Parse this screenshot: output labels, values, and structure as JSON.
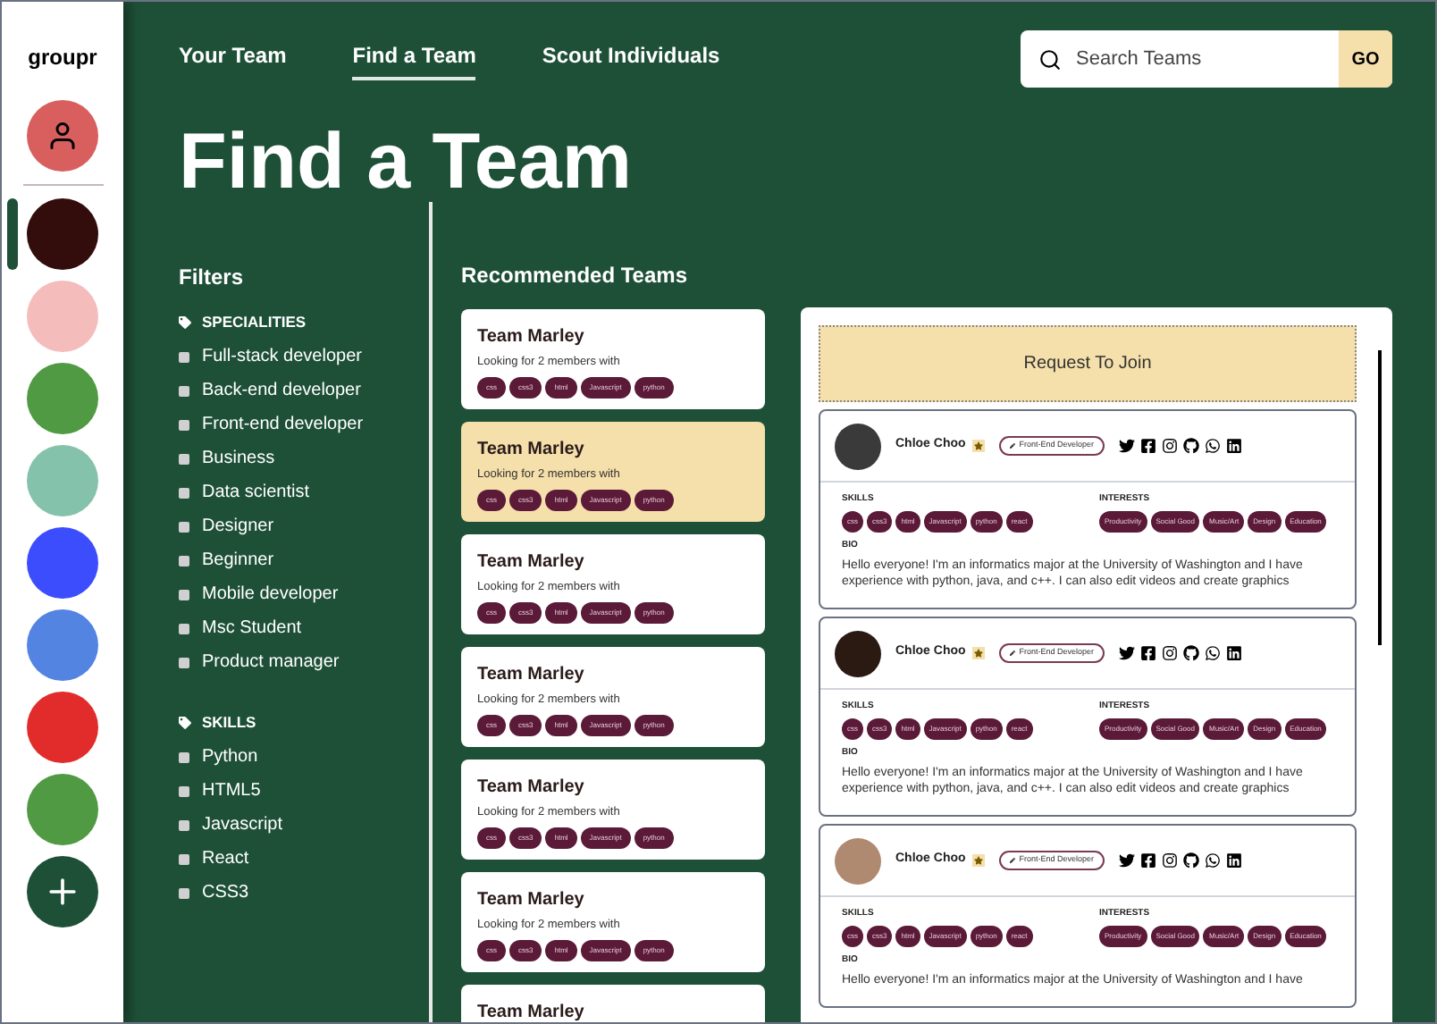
{
  "app": {
    "name": "groupr"
  },
  "groups": [
    {
      "color": "#330c0c",
      "selected": true
    },
    {
      "color": "#f5bcbc",
      "selected": false
    },
    {
      "color": "#4f9a42",
      "selected": false
    },
    {
      "color": "#85c2ab",
      "selected": false
    },
    {
      "color": "#3b4dfd",
      "selected": false
    },
    {
      "color": "#5384e2",
      "selected": false
    },
    {
      "color": "#e22b2b",
      "selected": false
    },
    {
      "color": "#4f9a42",
      "selected": false
    }
  ],
  "nav": [
    {
      "label": "Your Team",
      "selected": false
    },
    {
      "label": "Find a Team",
      "selected": true
    },
    {
      "label": "Scout Individuals",
      "selected": false
    }
  ],
  "search": {
    "placeholder": "Search Teams",
    "button": "GO"
  },
  "title": "Find a Team",
  "filters": {
    "title": "Filters",
    "sections": [
      {
        "heading": "SPECIALITIES",
        "items": [
          {
            "label": "Full-stack developer",
            "checked": false
          },
          {
            "label": "Back-end developer",
            "checked": false
          },
          {
            "label": "Front-end developer",
            "checked": false
          },
          {
            "label": "Business",
            "checked": false
          },
          {
            "label": "Data scientist",
            "checked": false
          },
          {
            "label": "Designer",
            "checked": false
          },
          {
            "label": "Beginner",
            "checked": false
          },
          {
            "label": "Mobile developer",
            "checked": false
          },
          {
            "label": "Msc Student",
            "checked": false
          },
          {
            "label": "Product manager",
            "checked": false
          }
        ]
      },
      {
        "heading": "SKILLS",
        "items": [
          {
            "label": "Python",
            "checked": false
          },
          {
            "label": "HTML5",
            "checked": false
          },
          {
            "label": "Javascript",
            "checked": false
          },
          {
            "label": "React",
            "checked": false
          },
          {
            "label": "CSS3",
            "checked": false
          }
        ]
      }
    ]
  },
  "recommended": {
    "title": "Recommended Teams",
    "teams": [
      {
        "name": "Team Marley",
        "selected": false,
        "looking": "Looking for 2 members with",
        "tags": [
          "css",
          "css3",
          "html",
          "Javascript",
          "python"
        ]
      },
      {
        "name": "Team Marley",
        "selected": true,
        "looking": "Looking for 2 members with",
        "tags": [
          "css",
          "css3",
          "html",
          "Javascript",
          "python"
        ]
      },
      {
        "name": "Team Marley",
        "selected": false,
        "looking": "Looking for 2 members with",
        "tags": [
          "css",
          "css3",
          "html",
          "Javascript",
          "python"
        ]
      },
      {
        "name": "Team Marley",
        "selected": false,
        "looking": "Looking for 2 members with",
        "tags": [
          "css",
          "css3",
          "html",
          "Javascript",
          "python"
        ]
      },
      {
        "name": "Team Marley",
        "selected": false,
        "looking": "Looking for 2 members with",
        "tags": [
          "css",
          "css3",
          "html",
          "Javascript",
          "python"
        ]
      },
      {
        "name": "Team Marley",
        "selected": false,
        "looking": "Looking for 2 members with",
        "tags": [
          "css",
          "css3",
          "html",
          "Javascript",
          "python"
        ]
      },
      {
        "name": "Team Marley",
        "selected": false
      }
    ]
  },
  "detail": {
    "request_button": "Request To Join",
    "members": [
      {
        "name": "Chloe Choo",
        "role": "Front-End Developer",
        "skills_label": "SKILLS",
        "skills": [
          "css",
          "css3",
          "html",
          "Javascript",
          "python",
          "react"
        ],
        "interests_label": "INTERESTS",
        "interests": [
          "Productivity",
          "Social Good",
          "Music/Art",
          "Design",
          "Education"
        ],
        "bio_label": "BIO",
        "bio": "Hello everyone! I'm an informatics major at the University of Washington and I have experience with python, java, and c++. I can also edit videos and create graphics"
      },
      {
        "name": "Chloe Choo",
        "role": "Front-End Developer",
        "skills_label": "SKILLS",
        "skills": [
          "css",
          "css3",
          "html",
          "Javascript",
          "python",
          "react"
        ],
        "interests_label": "INTERESTS",
        "interests": [
          "Productivity",
          "Social Good",
          "Music/Art",
          "Design",
          "Education"
        ],
        "bio_label": "BIO",
        "bio": "Hello everyone! I'm an informatics major at the University of Washington and I have experience with python, java, and c++. I can also edit videos and create graphics"
      },
      {
        "name": "Chloe Choo",
        "role": "Front-End Developer",
        "skills_label": "SKILLS",
        "skills": [
          "css",
          "css3",
          "html",
          "Javascript",
          "python",
          "react"
        ],
        "interests_label": "INTERESTS",
        "interests": [
          "Productivity",
          "Social Good",
          "Music/Art",
          "Design",
          "Education"
        ],
        "bio_label": "BIO",
        "bio": "Hello everyone! I'm an informatics major at the University of Washington and I have"
      }
    ]
  }
}
